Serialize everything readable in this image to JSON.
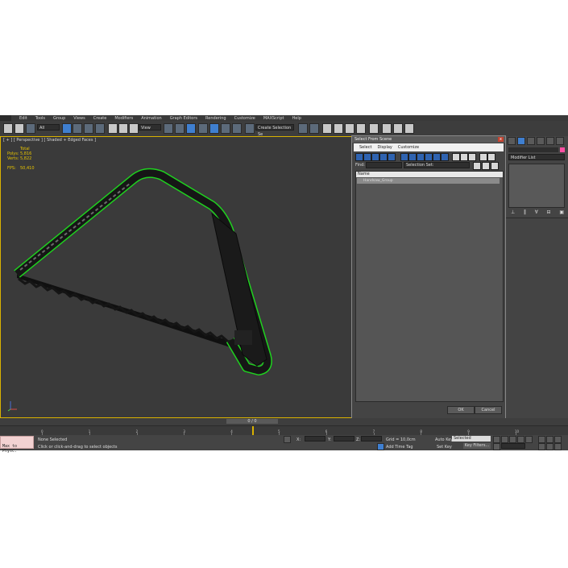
{
  "menubar": {
    "items": [
      "Edit",
      "Tools",
      "Group",
      "Views",
      "Create",
      "Modifiers",
      "Animation",
      "Graph Editors",
      "Rendering",
      "Customize",
      "MAXScript",
      "Help"
    ]
  },
  "toolbar": {
    "filter_value": "All",
    "view_value": "View",
    "selection_set_placeholder": "Create Selection Se"
  },
  "viewport": {
    "label": "[ + ] [ Perspective ] [ Shaded + Edged Faces ]"
  },
  "stats": {
    "total_label": "Total",
    "polys_label": "Polys:",
    "polys_value": "5,816",
    "verts_label": "Verts:",
    "verts_value": "5,822",
    "fps_label": "FPS:",
    "fps_value": "50,410"
  },
  "dialog": {
    "title": "Select From Scene",
    "close": "x",
    "menu": [
      "Select",
      "Display",
      "Customize"
    ],
    "find_label": "Find:",
    "selection_set_label": "Selection Set:",
    "column_name": "Name",
    "items": [
      "Handsaw_Group"
    ],
    "ok_label": "OK",
    "cancel_label": "Cancel"
  },
  "command_panel": {
    "modifier_list": "Modifier List"
  },
  "timeline": {
    "frame": "0 / 0"
  },
  "ruler": {
    "ticks": [
      "0",
      "1",
      "2",
      "3",
      "4",
      "5",
      "6",
      "7",
      "8",
      "9",
      "10"
    ]
  },
  "status": {
    "maxscript_label": "Max to Physc.",
    "selection": "None Selected",
    "prompt": "Click or click-and-drag to select objects",
    "x_label": "X:",
    "y_label": "Y:",
    "z_label": "Z:",
    "grid": "Grid = 10,0cm",
    "add_time_tag": "Add Time Tag",
    "auto_key": "Auto Key",
    "selected_dropdown": "Selected",
    "set_key": "Set Key",
    "key_filters": "Key Filters..."
  },
  "colors": {
    "accent": "#d9b200",
    "selection_blue": "#3f7fd0",
    "wire_green": "#1fd11f",
    "object_color": "#ff4fa3"
  }
}
